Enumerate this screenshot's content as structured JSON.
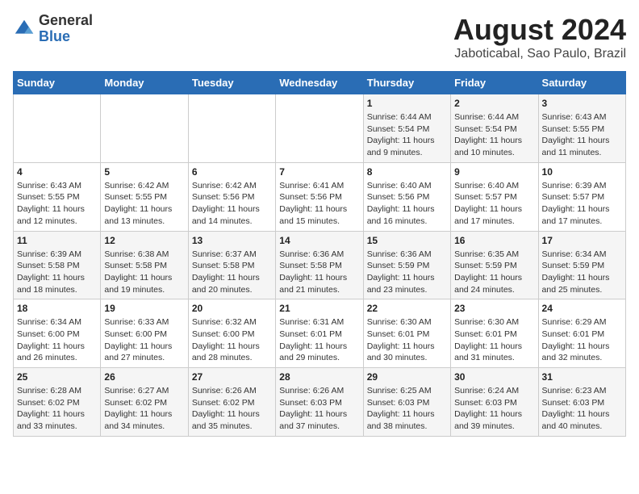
{
  "header": {
    "logo_general": "General",
    "logo_blue": "Blue",
    "month_year": "August 2024",
    "location": "Jaboticabal, Sao Paulo, Brazil"
  },
  "days_of_week": [
    "Sunday",
    "Monday",
    "Tuesday",
    "Wednesday",
    "Thursday",
    "Friday",
    "Saturday"
  ],
  "weeks": [
    [
      {
        "day": "",
        "info": ""
      },
      {
        "day": "",
        "info": ""
      },
      {
        "day": "",
        "info": ""
      },
      {
        "day": "",
        "info": ""
      },
      {
        "day": "1",
        "info": "Sunrise: 6:44 AM\nSunset: 5:54 PM\nDaylight: 11 hours\nand 9 minutes."
      },
      {
        "day": "2",
        "info": "Sunrise: 6:44 AM\nSunset: 5:54 PM\nDaylight: 11 hours\nand 10 minutes."
      },
      {
        "day": "3",
        "info": "Sunrise: 6:43 AM\nSunset: 5:55 PM\nDaylight: 11 hours\nand 11 minutes."
      }
    ],
    [
      {
        "day": "4",
        "info": "Sunrise: 6:43 AM\nSunset: 5:55 PM\nDaylight: 11 hours\nand 12 minutes."
      },
      {
        "day": "5",
        "info": "Sunrise: 6:42 AM\nSunset: 5:55 PM\nDaylight: 11 hours\nand 13 minutes."
      },
      {
        "day": "6",
        "info": "Sunrise: 6:42 AM\nSunset: 5:56 PM\nDaylight: 11 hours\nand 14 minutes."
      },
      {
        "day": "7",
        "info": "Sunrise: 6:41 AM\nSunset: 5:56 PM\nDaylight: 11 hours\nand 15 minutes."
      },
      {
        "day": "8",
        "info": "Sunrise: 6:40 AM\nSunset: 5:56 PM\nDaylight: 11 hours\nand 16 minutes."
      },
      {
        "day": "9",
        "info": "Sunrise: 6:40 AM\nSunset: 5:57 PM\nDaylight: 11 hours\nand 17 minutes."
      },
      {
        "day": "10",
        "info": "Sunrise: 6:39 AM\nSunset: 5:57 PM\nDaylight: 11 hours\nand 17 minutes."
      }
    ],
    [
      {
        "day": "11",
        "info": "Sunrise: 6:39 AM\nSunset: 5:58 PM\nDaylight: 11 hours\nand 18 minutes."
      },
      {
        "day": "12",
        "info": "Sunrise: 6:38 AM\nSunset: 5:58 PM\nDaylight: 11 hours\nand 19 minutes."
      },
      {
        "day": "13",
        "info": "Sunrise: 6:37 AM\nSunset: 5:58 PM\nDaylight: 11 hours\nand 20 minutes."
      },
      {
        "day": "14",
        "info": "Sunrise: 6:36 AM\nSunset: 5:58 PM\nDaylight: 11 hours\nand 21 minutes."
      },
      {
        "day": "15",
        "info": "Sunrise: 6:36 AM\nSunset: 5:59 PM\nDaylight: 11 hours\nand 23 minutes."
      },
      {
        "day": "16",
        "info": "Sunrise: 6:35 AM\nSunset: 5:59 PM\nDaylight: 11 hours\nand 24 minutes."
      },
      {
        "day": "17",
        "info": "Sunrise: 6:34 AM\nSunset: 5:59 PM\nDaylight: 11 hours\nand 25 minutes."
      }
    ],
    [
      {
        "day": "18",
        "info": "Sunrise: 6:34 AM\nSunset: 6:00 PM\nDaylight: 11 hours\nand 26 minutes."
      },
      {
        "day": "19",
        "info": "Sunrise: 6:33 AM\nSunset: 6:00 PM\nDaylight: 11 hours\nand 27 minutes."
      },
      {
        "day": "20",
        "info": "Sunrise: 6:32 AM\nSunset: 6:00 PM\nDaylight: 11 hours\nand 28 minutes."
      },
      {
        "day": "21",
        "info": "Sunrise: 6:31 AM\nSunset: 6:01 PM\nDaylight: 11 hours\nand 29 minutes."
      },
      {
        "day": "22",
        "info": "Sunrise: 6:30 AM\nSunset: 6:01 PM\nDaylight: 11 hours\nand 30 minutes."
      },
      {
        "day": "23",
        "info": "Sunrise: 6:30 AM\nSunset: 6:01 PM\nDaylight: 11 hours\nand 31 minutes."
      },
      {
        "day": "24",
        "info": "Sunrise: 6:29 AM\nSunset: 6:01 PM\nDaylight: 11 hours\nand 32 minutes."
      }
    ],
    [
      {
        "day": "25",
        "info": "Sunrise: 6:28 AM\nSunset: 6:02 PM\nDaylight: 11 hours\nand 33 minutes."
      },
      {
        "day": "26",
        "info": "Sunrise: 6:27 AM\nSunset: 6:02 PM\nDaylight: 11 hours\nand 34 minutes."
      },
      {
        "day": "27",
        "info": "Sunrise: 6:26 AM\nSunset: 6:02 PM\nDaylight: 11 hours\nand 35 minutes."
      },
      {
        "day": "28",
        "info": "Sunrise: 6:26 AM\nSunset: 6:03 PM\nDaylight: 11 hours\nand 37 minutes."
      },
      {
        "day": "29",
        "info": "Sunrise: 6:25 AM\nSunset: 6:03 PM\nDaylight: 11 hours\nand 38 minutes."
      },
      {
        "day": "30",
        "info": "Sunrise: 6:24 AM\nSunset: 6:03 PM\nDaylight: 11 hours\nand 39 minutes."
      },
      {
        "day": "31",
        "info": "Sunrise: 6:23 AM\nSunset: 6:03 PM\nDaylight: 11 hours\nand 40 minutes."
      }
    ]
  ]
}
